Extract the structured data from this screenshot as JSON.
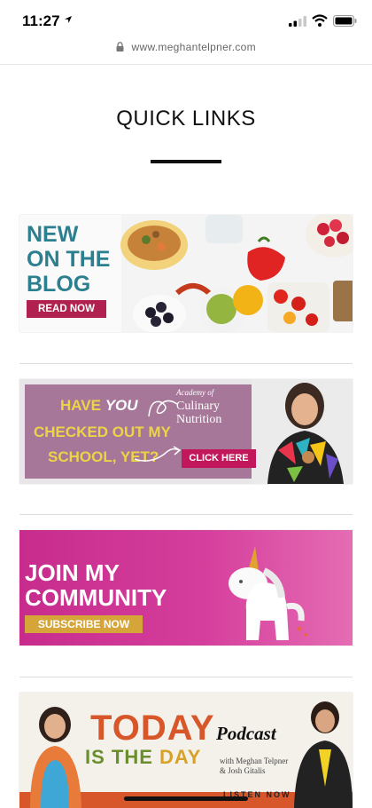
{
  "status_bar": {
    "time": "11:27"
  },
  "browser": {
    "url": "www.meghantelpner.com"
  },
  "page": {
    "title": "QUICK LINKS"
  },
  "banners": [
    {
      "heading_lines": [
        "NEW",
        "ON THE",
        "BLOG"
      ],
      "button": "READ NOW"
    },
    {
      "line1_a": "HAVE ",
      "line1_b": "YOU",
      "line2": "CHECKED OUT MY",
      "line3": "SCHOOL, YET?",
      "brand_lines": [
        "Academy of",
        "Culinary",
        "Nutrition"
      ],
      "button": "CLICK HERE"
    },
    {
      "heading_lines": [
        "JOIN MY",
        "COMMUNITY"
      ],
      "button": "SUBSCRIBE NOW"
    },
    {
      "title1": "TODAY",
      "title2a": "IS THE ",
      "title2b": "DAY",
      "podcast": "Podcast",
      "with_lines": [
        "with Meghan Telpner",
        "& Josh Gitalis"
      ],
      "listen": "LISTEN NOW"
    }
  ],
  "colors": {
    "teal": "#2b7f8f",
    "raspberry": "#b0214f",
    "mauve": "#a7779a",
    "magenta": "#c72c8c",
    "gold": "#d6a53a",
    "orange": "#d8572a"
  }
}
